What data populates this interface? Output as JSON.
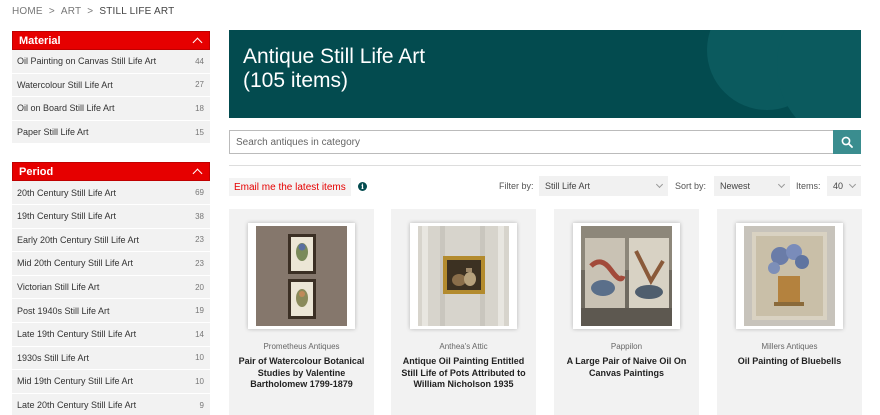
{
  "breadcrumb": {
    "home": "HOME",
    "art": "ART",
    "current": "STILL LIFE ART",
    "separator": ">"
  },
  "sidebar": {
    "material": {
      "title": "Material",
      "items": [
        {
          "label": "Oil Painting on Canvas Still Life Art",
          "count": "44"
        },
        {
          "label": "Watercolour Still Life Art",
          "count": "27"
        },
        {
          "label": "Oil on Board Still Life Art",
          "count": "18"
        },
        {
          "label": "Paper Still Life Art",
          "count": "15"
        }
      ]
    },
    "period": {
      "title": "Period",
      "items": [
        {
          "label": "20th Century Still Life Art",
          "count": "69"
        },
        {
          "label": "19th Century Still Life Art",
          "count": "38"
        },
        {
          "label": "Early 20th Century Still Life Art",
          "count": "23"
        },
        {
          "label": "Mid 20th Century Still Life Art",
          "count": "23"
        },
        {
          "label": "Victorian Still Life Art",
          "count": "20"
        },
        {
          "label": "Post 1940s Still Life Art",
          "count": "19"
        },
        {
          "label": "Late 19th Century Still Life Art",
          "count": "14"
        },
        {
          "label": "1930s Still Life Art",
          "count": "10"
        },
        {
          "label": "Mid 19th Century Still Life Art",
          "count": "10"
        },
        {
          "label": "Late 20th Century Still Life Art",
          "count": "9"
        }
      ]
    }
  },
  "hero": {
    "title_line1": "Antique Still Life Art",
    "title_line2": "(105 items)",
    "color": "#034b4f"
  },
  "search": {
    "placeholder": "Search antiques in category",
    "value": ""
  },
  "toolbar": {
    "email_label": "Email me the latest items",
    "info_glyph": "i",
    "filter_label": "Filter by:",
    "filter_value": "Still Life Art",
    "sort_label": "Sort by:",
    "sort_value": "Newest",
    "items_label": "Items:",
    "items_value": "40"
  },
  "products": [
    {
      "dealer": "Prometheus Antiques",
      "title": "Pair of Watercolour Botanical Studies by Valentine Bartholomew 1799-1879"
    },
    {
      "dealer": "Anthea's Attic",
      "title": "Antique Oil Painting Entitled Still Life of Pots Attributed to William Nicholson 1935"
    },
    {
      "dealer": "Pappilon",
      "title": "A Large Pair of Naive Oil On Canvas Paintings"
    },
    {
      "dealer": "Millers Antiques",
      "title": "Oil Painting of Bluebells"
    }
  ],
  "colors": {
    "accent_red": "#e60000",
    "teal": "#034b4f",
    "search_button": "#3a8d8f"
  }
}
